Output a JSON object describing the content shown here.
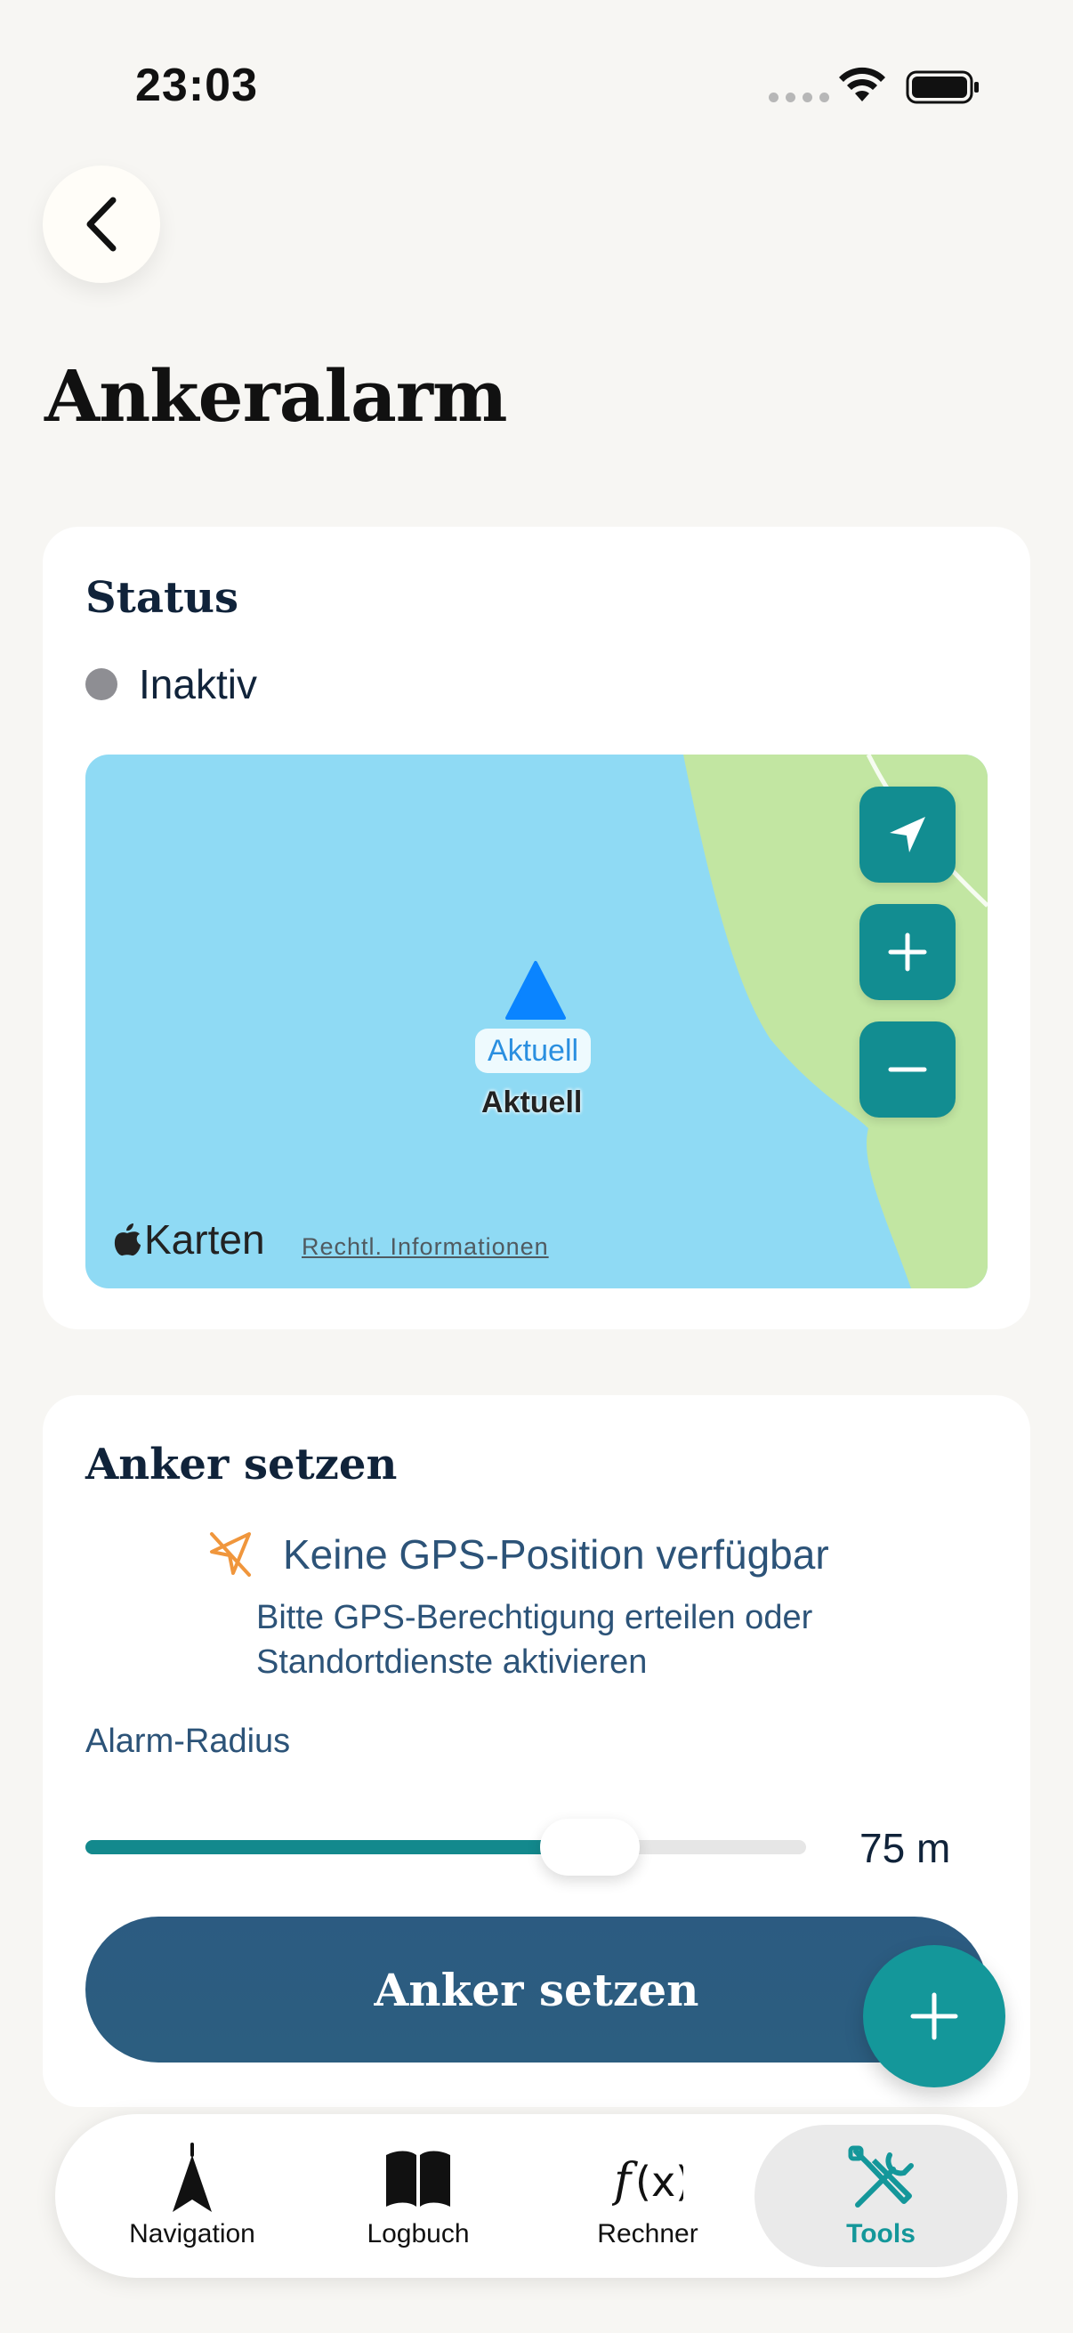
{
  "status_bar": {
    "time": "23:03"
  },
  "header": {
    "title": "Ankeralarm"
  },
  "status_card": {
    "title": "Status",
    "state": "Inaktiv",
    "state_color": "#8E8E93",
    "map": {
      "marker_badge": "Aktuell",
      "marker_name": "Aktuell",
      "attribution": "Karten",
      "legal_link": "Rechtl. Informationen",
      "buttons": [
        "location-arrow-icon",
        "zoom-in-icon",
        "zoom-out-icon"
      ]
    }
  },
  "anchor_card": {
    "title": "Anker setzen",
    "gps_warning_title": "Keine GPS-Position verfügbar",
    "gps_warning_text": "Bitte GPS-Berechtigung erteilen oder Standortdienste aktivieren",
    "radius_label": "Alarm-Radius",
    "radius_fraction": 0.7,
    "radius_value": "75 m",
    "button_label": "Anker setzen"
  },
  "tabs": [
    {
      "label": "Navigation",
      "icon": "navigation-arrow-icon",
      "active": false
    },
    {
      "label": "Logbuch",
      "icon": "book-icon",
      "active": false
    },
    {
      "label": "Rechner",
      "icon": "function-icon",
      "active": false
    },
    {
      "label": "Tools",
      "icon": "tools-icon",
      "active": true
    }
  ],
  "colors": {
    "accent": "#14979A",
    "primary_button": "#2C5B81",
    "map_water": "#8FDAF4",
    "map_land": "#C2E6A2"
  }
}
